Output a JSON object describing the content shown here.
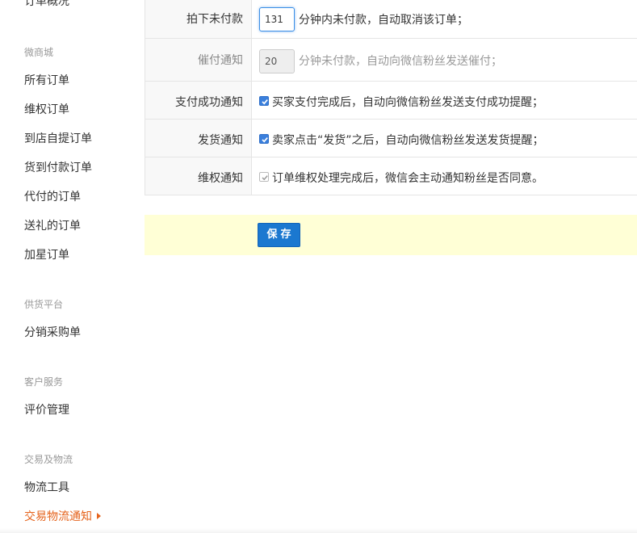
{
  "sidebar": {
    "cut_item": "订单概况",
    "groups": [
      {
        "title": "微商城",
        "items": [
          "所有订单",
          "维权订单",
          "到店自提订单",
          "货到付款订单",
          "代付的订单",
          "送礼的订单",
          "加星订单"
        ]
      },
      {
        "title": "供货平台",
        "items": [
          "分销采购单"
        ]
      },
      {
        "title": "客户服务",
        "items": [
          "评价管理"
        ]
      },
      {
        "title": "交易及物流",
        "items": [
          "物流工具",
          "交易物流通知"
        ]
      }
    ],
    "active_item": "交易物流通知",
    "accent_color": "#e5631c"
  },
  "settings": {
    "unpaid": {
      "label": "拍下未付款",
      "value": "131",
      "suffix": "分钟内未付款，自动取消该订单；"
    },
    "remind": {
      "label": "催付通知",
      "value": "20",
      "suffix": "分钟未付款，自动向微信粉丝发送催付；"
    },
    "paid_notice": {
      "label": "支付成功通知",
      "checked": true,
      "text": "买家支付完成后，自动向微信粉丝发送支付成功提醒；"
    },
    "ship_notice": {
      "label": "发货通知",
      "checked": true,
      "text": "卖家点击“发货”之后，自动向微信粉丝发送发货提醒；"
    },
    "rights_notice": {
      "label": "维权通知",
      "checked": true,
      "disabled": true,
      "text": "订单维权处理完成后，微信会主动通知粉丝是否同意。"
    }
  },
  "save_button": {
    "label": "保存",
    "color": "#1b78d0"
  },
  "save_bar_color": "#ffffd6"
}
